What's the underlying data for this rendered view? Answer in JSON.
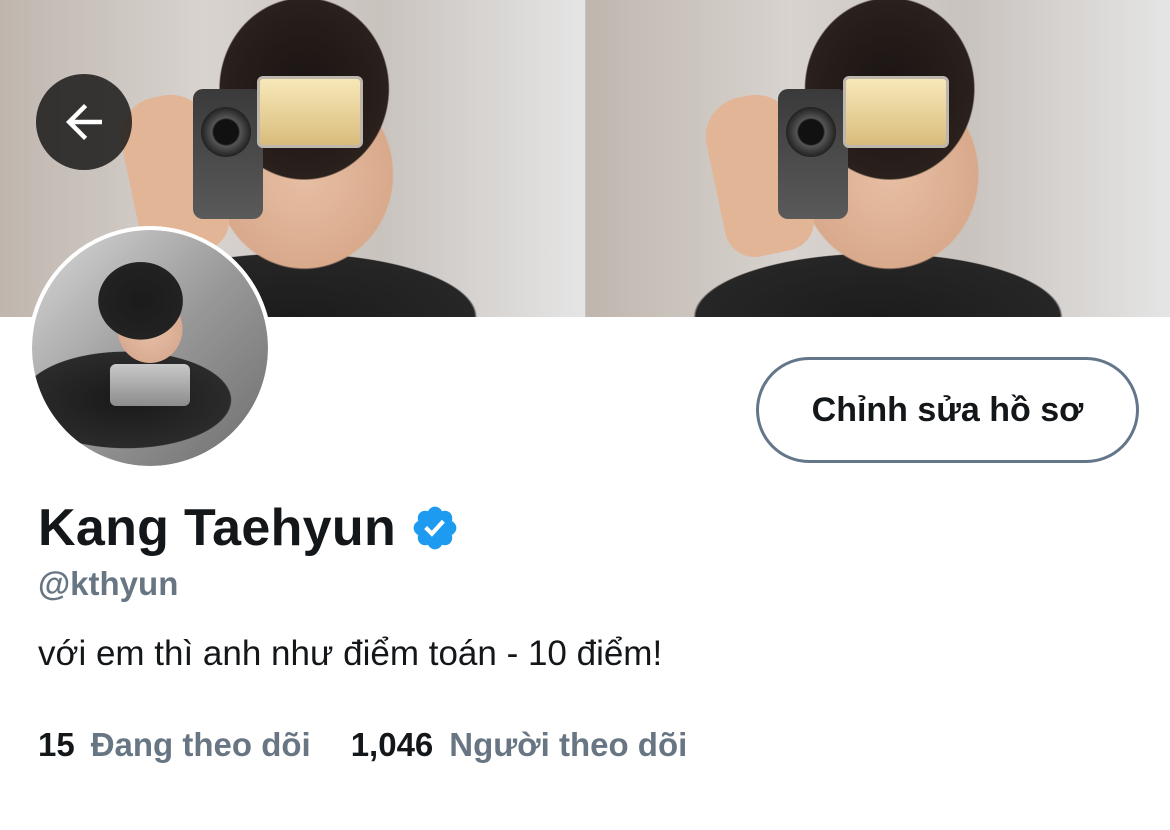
{
  "header": {
    "back_icon": "arrow-left-icon"
  },
  "profile": {
    "display_name": "Kang Taehyun",
    "verified_icon": "verified-badge-icon",
    "handle": "@kthyun",
    "bio": "với em thì anh như điểm toán - 10 điểm!",
    "edit_button_label": "Chỉnh sửa hồ sơ"
  },
  "stats": {
    "following_count": "15",
    "following_label": "Đang theo dõi",
    "followers_count": "1,046",
    "followers_label": "Người theo dõi"
  },
  "colors": {
    "verified_blue": "#1d9bf0",
    "secondary_text": "#687684",
    "button_border": "#63768a"
  }
}
